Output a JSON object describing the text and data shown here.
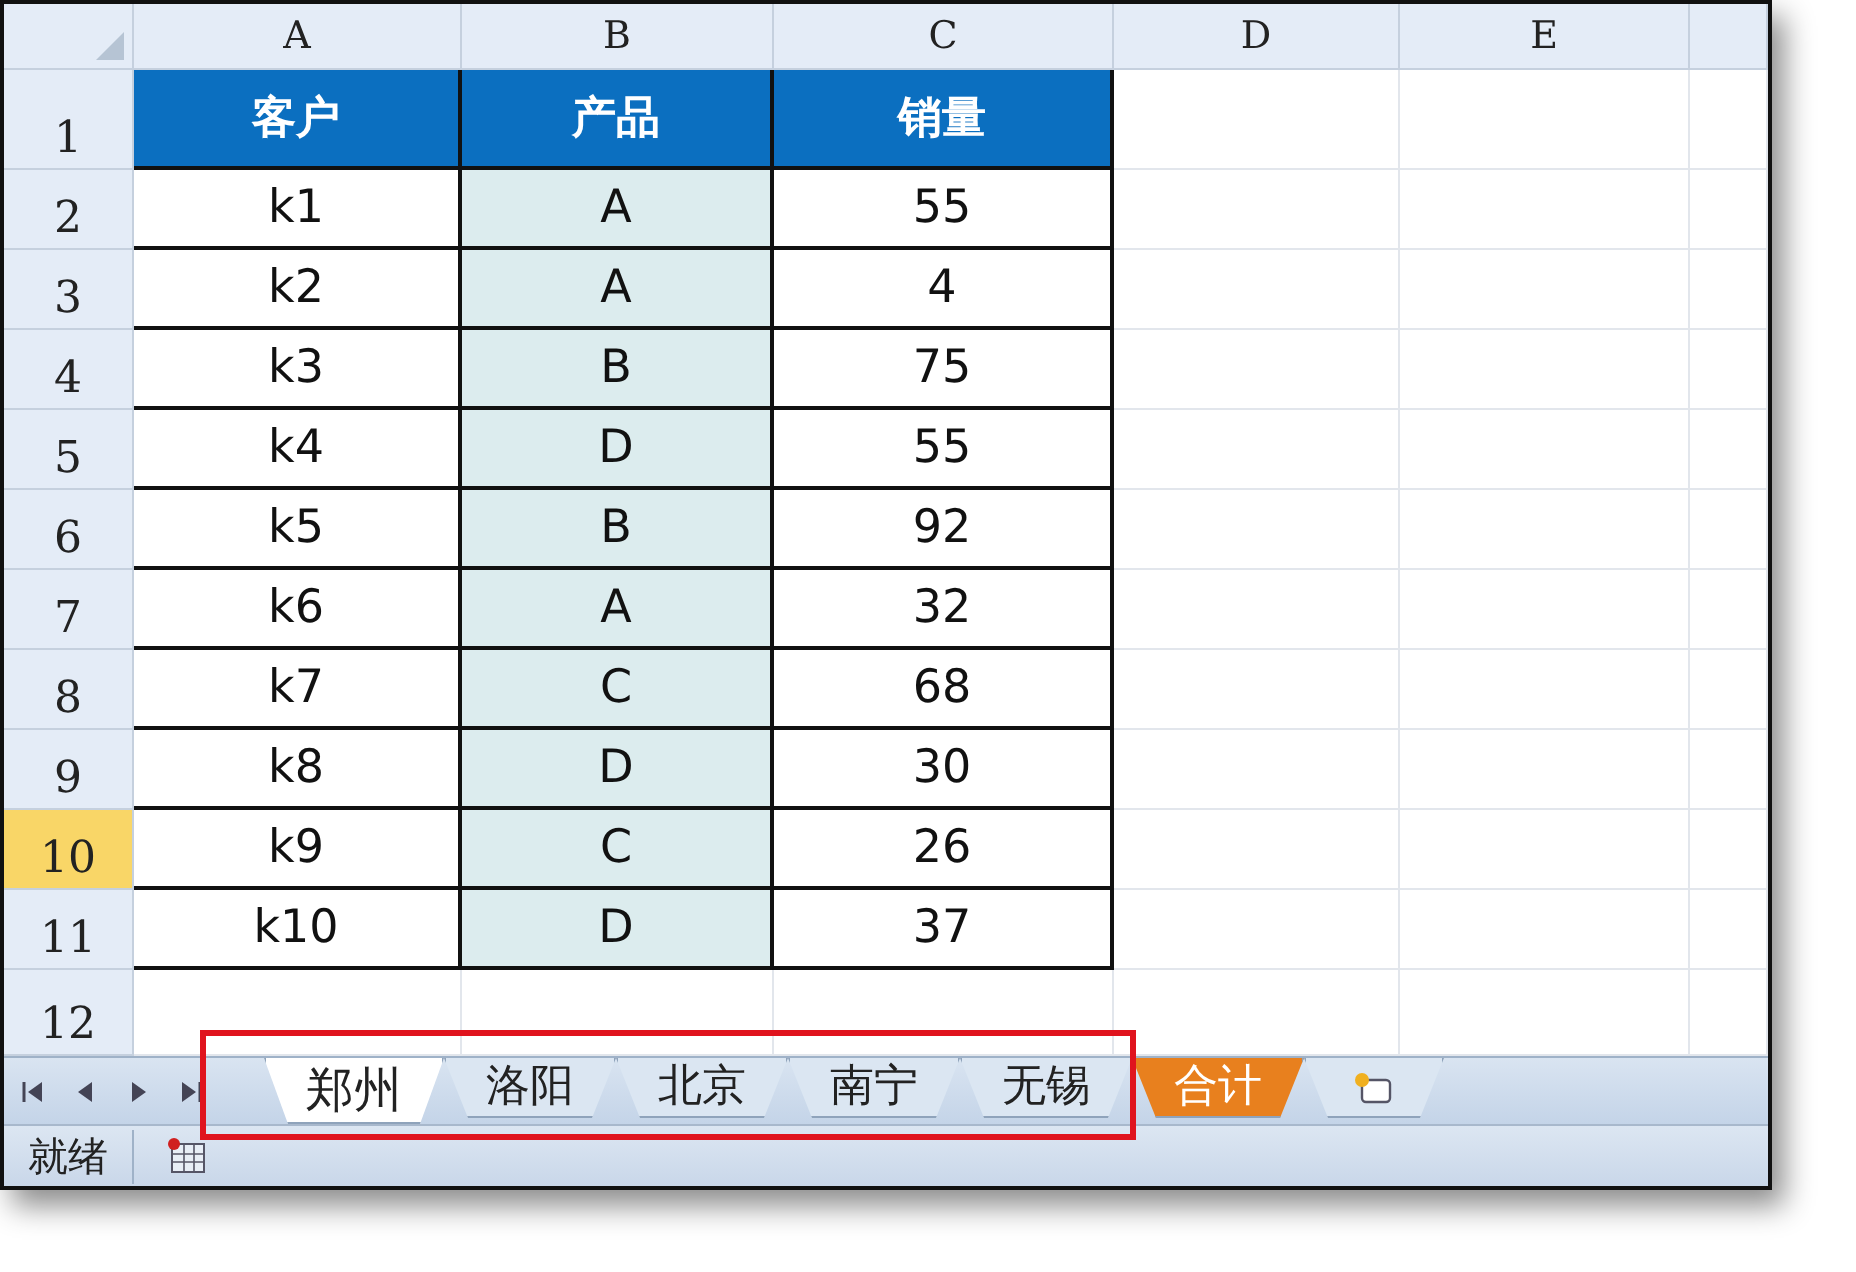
{
  "columns": [
    {
      "label": "A",
      "selected": false
    },
    {
      "label": "B",
      "selected": false
    },
    {
      "label": "C",
      "selected": false
    },
    {
      "label": "D",
      "selected": false
    },
    {
      "label": "E",
      "selected": false
    }
  ],
  "header_row": {
    "number": "1",
    "selected": false,
    "cells": [
      "客户",
      "产品",
      "销量"
    ]
  },
  "rows": [
    {
      "number": "2",
      "selected": false,
      "cells": [
        "k1",
        "A",
        "55"
      ]
    },
    {
      "number": "3",
      "selected": false,
      "cells": [
        "k2",
        "A",
        "4"
      ]
    },
    {
      "number": "4",
      "selected": false,
      "cells": [
        "k3",
        "B",
        "75"
      ]
    },
    {
      "number": "5",
      "selected": false,
      "cells": [
        "k4",
        "D",
        "55"
      ]
    },
    {
      "number": "6",
      "selected": false,
      "cells": [
        "k5",
        "B",
        "92"
      ]
    },
    {
      "number": "7",
      "selected": false,
      "cells": [
        "k6",
        "A",
        "32"
      ]
    },
    {
      "number": "8",
      "selected": false,
      "cells": [
        "k7",
        "C",
        "68"
      ]
    },
    {
      "number": "9",
      "selected": false,
      "cells": [
        "k8",
        "D",
        "30"
      ]
    },
    {
      "number": "10",
      "selected": true,
      "cells": [
        "k9",
        "C",
        "26"
      ]
    },
    {
      "number": "11",
      "selected": false,
      "cells": [
        "k10",
        "D",
        "37"
      ]
    },
    {
      "number": "12",
      "selected": false,
      "cells": []
    }
  ],
  "sheet_tabs": [
    {
      "label": "郑州",
      "selected": true,
      "color": "#ffffff"
    },
    {
      "label": "洛阳",
      "selected": false,
      "color": "#dbe6f2"
    },
    {
      "label": "北京",
      "selected": false,
      "color": "#dbe6f2"
    },
    {
      "label": "南宁",
      "selected": false,
      "color": "#dbe6f2"
    },
    {
      "label": "无锡",
      "selected": false,
      "color": "#dbe6f2"
    },
    {
      "label": "合计",
      "selected": false,
      "color": "#e8801e"
    }
  ],
  "status_bar": {
    "text": "就绪"
  }
}
